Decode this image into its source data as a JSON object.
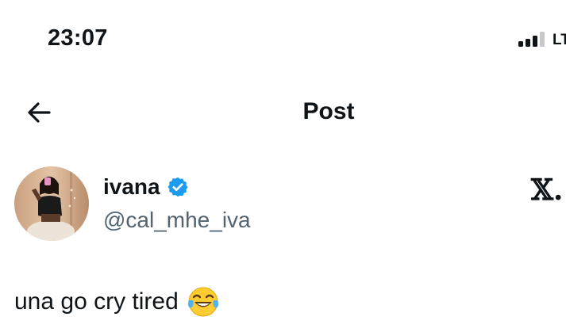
{
  "status_bar": {
    "time": "23:07",
    "network": "LT"
  },
  "header": {
    "title": "Post"
  },
  "post": {
    "author": {
      "display_name": "ivana",
      "handle": "@cal_mhe_iva",
      "verified": true
    },
    "text": "una go cry tired",
    "emoji": "face-with-tears-of-joy"
  },
  "colors": {
    "text": "#0f1419",
    "secondary_text": "#536471",
    "verified_blue": "#1d9bf0"
  }
}
